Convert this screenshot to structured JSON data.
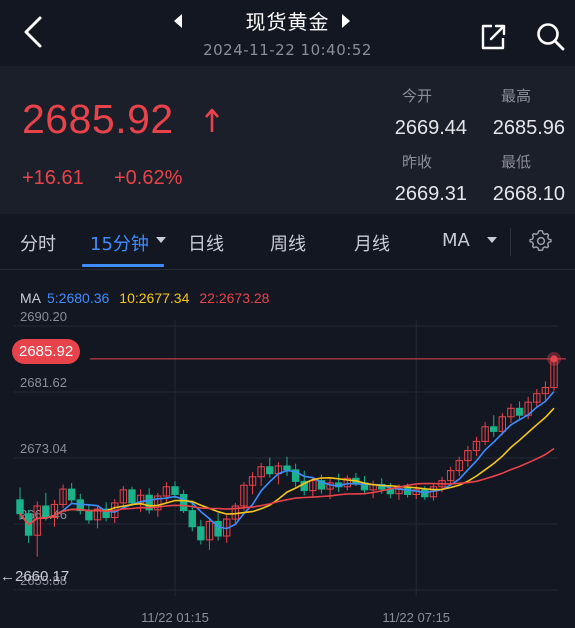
{
  "header": {
    "title": "现货黄金",
    "subtitle": "2024-11-22 10:40:52"
  },
  "quote": {
    "price": "2685.92",
    "change": "+16.61",
    "change_pct": "+0.62%",
    "stats": {
      "open_label": "今开",
      "open_value": "2669.44",
      "high_label": "最高",
      "high_value": "2685.96",
      "prev_close_label": "昨收",
      "prev_close_value": "2669.31",
      "low_label": "最低",
      "low_value": "2668.10"
    },
    "up_color": "#e8434a"
  },
  "tabs": {
    "items": [
      {
        "label": "分时"
      },
      {
        "label": "15分钟"
      },
      {
        "label": "日线"
      },
      {
        "label": "周线"
      },
      {
        "label": "月线"
      },
      {
        "label": "MA"
      }
    ],
    "active_index": 1,
    "accent": "#3f8cff"
  },
  "chart": {
    "ma_label": "MA",
    "ma5": "5:2680.36",
    "ma10": "10:2677.34",
    "ma22": "22:2673.28",
    "ma_colors": {
      "ma5": "#3f8cff",
      "ma10": "#f5c518",
      "ma22": "#e8434a"
    },
    "y_ticks": [
      "2690.20",
      "2681.62",
      "2673.04",
      "2664.46",
      "2655.88"
    ],
    "current_price_badge": "2685.92",
    "min_marker": "←2660.17",
    "x_ticks": [
      "11/22 01:15",
      "11/22 07:15"
    ]
  },
  "chart_data": {
    "type": "candlestick",
    "ylim": [
      2655.88,
      2690.2
    ],
    "y_ticks": [
      2690.2,
      2681.62,
      2673.04,
      2664.46,
      2655.88
    ],
    "x_ticks": [
      "11/22 01:15",
      "11/22 07:15"
    ],
    "last_price": 2685.92,
    "min_price": 2660.17,
    "indicators": [
      {
        "name": "MA5",
        "value": 2680.36
      },
      {
        "name": "MA10",
        "value": 2677.34
      },
      {
        "name": "MA22",
        "value": 2673.28
      }
    ],
    "candles": [
      [
        2667.6,
        2669.2,
        2665.0,
        2665.8
      ],
      [
        2665.8,
        2666.3,
        2662.0,
        2663.0
      ],
      [
        2663.0,
        2667.4,
        2660.2,
        2666.8
      ],
      [
        2666.8,
        2668.5,
        2664.9,
        2665.3
      ],
      [
        2665.3,
        2667.6,
        2664.1,
        2667.0
      ],
      [
        2667.0,
        2669.6,
        2666.5,
        2669.0
      ],
      [
        2669.0,
        2669.8,
        2667.1,
        2667.6
      ],
      [
        2667.6,
        2668.4,
        2665.7,
        2666.2
      ],
      [
        2666.2,
        2666.9,
        2664.5,
        2665.0
      ],
      [
        2665.0,
        2666.8,
        2663.9,
        2666.4
      ],
      [
        2666.4,
        2667.3,
        2664.8,
        2665.3
      ],
      [
        2665.3,
        2667.7,
        2664.6,
        2667.2
      ],
      [
        2667.2,
        2669.4,
        2666.3,
        2668.9
      ],
      [
        2668.9,
        2669.3,
        2666.8,
        2667.2
      ],
      [
        2667.2,
        2669.0,
        2666.0,
        2668.2
      ],
      [
        2668.2,
        2669.1,
        2665.8,
        2666.3
      ],
      [
        2666.3,
        2668.5,
        2665.4,
        2668.1
      ],
      [
        2668.1,
        2669.9,
        2667.2,
        2669.3
      ],
      [
        2669.3,
        2670.0,
        2667.8,
        2668.3
      ],
      [
        2668.3,
        2668.9,
        2665.9,
        2666.2
      ],
      [
        2666.2,
        2667.3,
        2663.5,
        2664.1
      ],
      [
        2664.1,
        2665.0,
        2661.8,
        2662.4
      ],
      [
        2662.4,
        2665.2,
        2661.1,
        2664.8
      ],
      [
        2664.8,
        2665.9,
        2662.3,
        2662.9
      ],
      [
        2662.9,
        2665.6,
        2662.0,
        2665.1
      ],
      [
        2665.1,
        2667.2,
        2664.4,
        2666.8
      ],
      [
        2666.8,
        2669.9,
        2666.2,
        2669.5
      ],
      [
        2669.5,
        2671.2,
        2668.3,
        2670.6
      ],
      [
        2670.6,
        2672.4,
        2669.4,
        2671.9
      ],
      [
        2671.9,
        2673.1,
        2670.5,
        2671.0
      ],
      [
        2671.0,
        2672.5,
        2669.6,
        2672.0
      ],
      [
        2672.0,
        2673.2,
        2670.7,
        2671.5
      ],
      [
        2671.5,
        2672.3,
        2669.3,
        2670.0
      ],
      [
        2670.0,
        2671.4,
        2668.2,
        2668.8
      ],
      [
        2668.8,
        2670.6,
        2667.9,
        2670.1
      ],
      [
        2670.1,
        2670.9,
        2668.4,
        2669.0
      ],
      [
        2669.0,
        2670.3,
        2667.7,
        2669.8
      ],
      [
        2669.8,
        2671.0,
        2668.6,
        2669.3
      ],
      [
        2669.3,
        2670.8,
        2668.8,
        2670.4
      ],
      [
        2670.4,
        2671.1,
        2669.4,
        2669.8
      ],
      [
        2669.8,
        2670.7,
        2668.3,
        2668.9
      ],
      [
        2668.9,
        2670.1,
        2667.8,
        2669.6
      ],
      [
        2669.6,
        2670.4,
        2668.4,
        2669.0
      ],
      [
        2669.0,
        2669.8,
        2667.8,
        2668.4
      ],
      [
        2668.4,
        2669.6,
        2667.6,
        2669.1
      ],
      [
        2669.1,
        2669.7,
        2667.9,
        2668.3
      ],
      [
        2668.3,
        2669.5,
        2667.7,
        2668.9
      ],
      [
        2668.9,
        2669.4,
        2667.6,
        2668.0
      ],
      [
        2668.0,
        2669.7,
        2667.5,
        2669.3
      ],
      [
        2669.3,
        2670.6,
        2668.6,
        2670.1
      ],
      [
        2670.1,
        2671.9,
        2669.6,
        2671.4
      ],
      [
        2671.4,
        2673.2,
        2670.7,
        2672.7
      ],
      [
        2672.7,
        2674.6,
        2671.9,
        2674.0
      ],
      [
        2674.0,
        2675.8,
        2673.3,
        2675.2
      ],
      [
        2675.2,
        2677.7,
        2674.7,
        2677.1
      ],
      [
        2677.1,
        2678.6,
        2675.8,
        2676.5
      ],
      [
        2676.5,
        2678.9,
        2676.0,
        2678.4
      ],
      [
        2678.4,
        2680.1,
        2677.6,
        2679.5
      ],
      [
        2679.5,
        2680.4,
        2677.9,
        2678.6
      ],
      [
        2678.6,
        2681.0,
        2678.1,
        2680.3
      ],
      [
        2680.3,
        2682.0,
        2679.6,
        2681.4
      ],
      [
        2681.4,
        2683.0,
        2680.6,
        2682.2
      ],
      [
        2682.2,
        2685.96,
        2681.8,
        2685.92
      ]
    ]
  }
}
